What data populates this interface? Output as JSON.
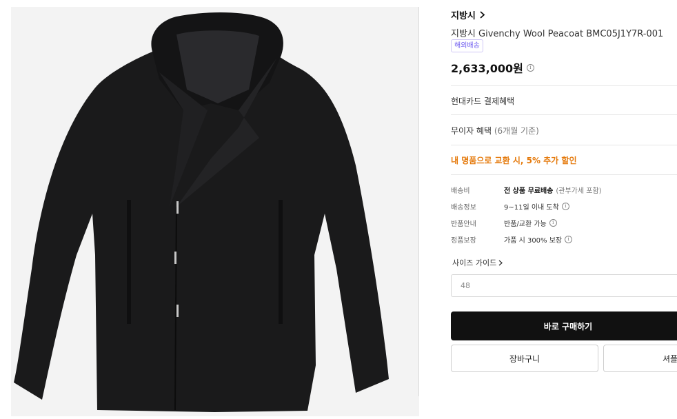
{
  "image": {
    "alt_icon": "coat-product-image"
  },
  "product": {
    "brand": "지방시",
    "name": "지방시 Givenchy Wool Peacoat BMC05J1Y7R-001",
    "badge": "해외배송",
    "price": "2,633,000원"
  },
  "benefits": {
    "card": "현대카드 결제혜택",
    "installment_main": "무이자 혜택",
    "installment_sub": "(6개월 기준)",
    "promo": "내 명품으로 교환 시, 5% 추가 할인"
  },
  "shipping": [
    {
      "label": "배송비",
      "value_bold": "전 상품 무료배송",
      "value_muted": "(관부가세 포함)"
    },
    {
      "label": "배송정보",
      "value": "9~11일 이내 도착"
    },
    {
      "label": "반품안내",
      "value": "반품/교환 가능"
    },
    {
      "label": "정품보장",
      "value": "가품 시 300% 보장"
    }
  ],
  "size": {
    "guide_label": "사이즈 가이드",
    "selected": "48"
  },
  "actions": {
    "buy": "바로 구매하기",
    "cart": "장바구니",
    "share": "셔플"
  },
  "colors": {
    "accent_promo": "#e57a0c",
    "badge": "#6f5cf0",
    "buy_bg": "#111111"
  }
}
